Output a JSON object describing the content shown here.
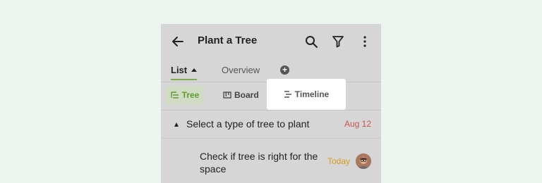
{
  "appbar": {
    "title": "Plant a Tree",
    "icons": [
      "back-arrow-icon",
      "search-icon",
      "filter-icon",
      "more-vert-icon"
    ]
  },
  "tabs": {
    "list": "List",
    "overview": "Overview",
    "add": "+"
  },
  "views": {
    "tree": "Tree",
    "board": "Board",
    "timeline": "Timeline"
  },
  "tasks": [
    {
      "title": "Select a type of tree to plant",
      "date": "Aug 12"
    },
    {
      "title": "Check if tree is right for the space",
      "date": "Today"
    }
  ],
  "colors": {
    "accent_green": "#7cab4c",
    "overdue_red": "#c7534d",
    "today_amber": "#d89a1d"
  }
}
